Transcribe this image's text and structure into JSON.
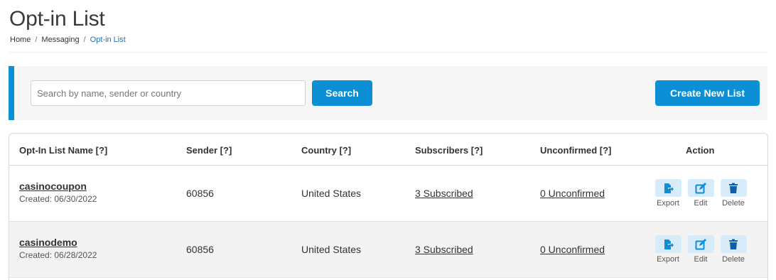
{
  "page": {
    "title": "Opt-in List",
    "breadcrumb": [
      "Home",
      "Messaging",
      "Opt-in List"
    ],
    "breadcrumb_sep": "/"
  },
  "search": {
    "placeholder": "Search by name, sender or country",
    "value": "",
    "button_label": "Search",
    "create_label": "Create New List"
  },
  "colors": {
    "accent": "#0d8fd6",
    "icon_bg": "#d8ebf8",
    "row_alt": "#f3f3f3"
  },
  "table": {
    "headers": {
      "name": "Opt-In List Name [?]",
      "sender": "Sender [?]",
      "country": "Country [?]",
      "subscribers": "Subscribers [?]",
      "unconfirmed": "Unconfirmed [?]",
      "action": "Action"
    },
    "rows": [
      {
        "name": "casinocoupon",
        "created": "Created: 06/30/2022",
        "sender": "60856",
        "country": "United States",
        "subscribers": "3 Subscribed",
        "unconfirmed": "0 Unconfirmed"
      },
      {
        "name": "casinodemo",
        "created": "Created: 06/28/2022",
        "sender": "60856",
        "country": "United States",
        "subscribers": "3 Subscribed",
        "unconfirmed": "0 Unconfirmed"
      }
    ],
    "actions": [
      {
        "label": "Export",
        "icon": "export-icon"
      },
      {
        "label": "Edit",
        "icon": "edit-icon"
      },
      {
        "label": "Delete",
        "icon": "trash-icon"
      }
    ]
  }
}
